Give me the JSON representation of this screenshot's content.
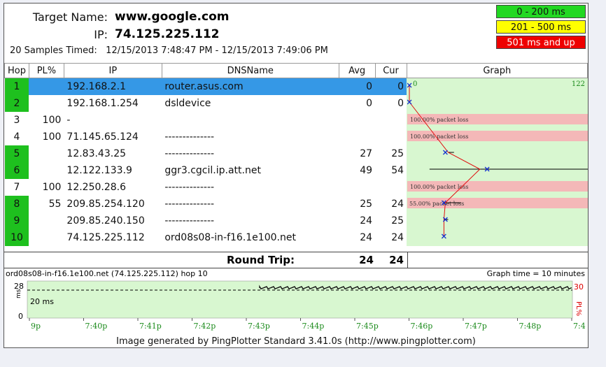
{
  "header": {
    "target_label": "Target Name:",
    "target_value": "www.google.com",
    "ip_label": "IP:",
    "ip_value": "74.125.225.112",
    "samples_text": "20 Samples Timed:   12/15/2013 7:48:47 PM - 12/15/2013 7:49:06 PM"
  },
  "legend": [
    {
      "label": "0 - 200 ms",
      "color": "#22d822",
      "text_color": "#111111"
    },
    {
      "label": "201 - 500 ms",
      "color": "#ffff00",
      "text_color": "#111111"
    },
    {
      "label": "501 ms and up",
      "color": "#ee0000",
      "text_color": "#ffffff"
    }
  ],
  "columns": [
    "Hop",
    "PL%",
    "IP",
    "DNSName",
    "Avg",
    "Cur",
    "Graph"
  ],
  "hops": [
    {
      "hop": "1",
      "pl": "",
      "ip": "192.168.2.1",
      "dns": "router.asus.com",
      "avg": "0",
      "cur": "0"
    },
    {
      "hop": "2",
      "pl": "",
      "ip": "192.168.1.254",
      "dns": "dsldevice",
      "avg": "0",
      "cur": "0"
    },
    {
      "hop": "3",
      "pl": "100",
      "ip": "-",
      "dns": "",
      "avg": "",
      "cur": ""
    },
    {
      "hop": "4",
      "pl": "100",
      "ip": "71.145.65.124",
      "dns": "--------------",
      "avg": "",
      "cur": ""
    },
    {
      "hop": "5",
      "pl": "",
      "ip": "12.83.43.25",
      "dns": "--------------",
      "avg": "27",
      "cur": "25"
    },
    {
      "hop": "6",
      "pl": "",
      "ip": "12.122.133.9",
      "dns": "ggr3.cgcil.ip.att.net",
      "avg": "49",
      "cur": "54"
    },
    {
      "hop": "7",
      "pl": "100",
      "ip": "12.250.28.6",
      "dns": "--------------",
      "avg": "",
      "cur": ""
    },
    {
      "hop": "8",
      "pl": "55",
      "ip": "209.85.254.120",
      "dns": "--------------",
      "avg": "25",
      "cur": "24"
    },
    {
      "hop": "9",
      "pl": "",
      "ip": "209.85.240.150",
      "dns": "--------------",
      "avg": "24",
      "cur": "25"
    },
    {
      "hop": "10",
      "pl": "",
      "ip": "74.125.225.112",
      "dns": "ord08s08-in-f16.1e100.net",
      "avg": "24",
      "cur": "24"
    }
  ],
  "graph": {
    "scale_min": "0",
    "scale_max": "122",
    "loss_labels": [
      "100.00% packet loss",
      "100.00% packet loss",
      "100.00% packet loss",
      "55.00% packet loss"
    ]
  },
  "round_trip": {
    "label": "Round Trip:",
    "avg": "24",
    "cur": "24"
  },
  "timegraph": {
    "title": "ord08s08-in-f16.1e100.net (74.125.225.112) hop 10",
    "graph_time": "Graph time = 10 minutes",
    "y_max": "28",
    "y_min": "0",
    "y_unit": "ms",
    "ref_label": "20 ms",
    "pl_max": "30",
    "pl_label": "PL%",
    "x_ticks": [
      "9p",
      "7:40p",
      "7:41p",
      "7:42p",
      "7:43p",
      "7:44p",
      "7:45p",
      "7:46p",
      "7:47p",
      "7:48p",
      "7:4"
    ]
  },
  "footer": "Image generated by PingPlotter Standard 3.41.0s (http://www.pingplotter.com)"
}
